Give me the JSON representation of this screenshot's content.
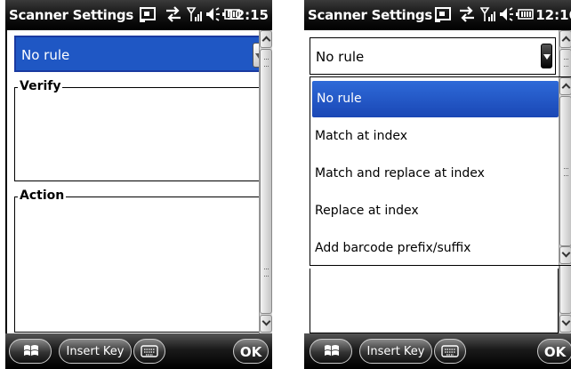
{
  "left": {
    "status_bar": {
      "title": "Scanner Settings",
      "time": "12:15"
    },
    "rule_combo": {
      "value": "No rule"
    },
    "groups": {
      "verify": "Verify",
      "action": "Action"
    },
    "softkeys": {
      "insert_key": "Insert Key",
      "ok": "OK"
    }
  },
  "right": {
    "status_bar": {
      "title": "Scanner Settings",
      "time": "12:16"
    },
    "rule_combo": {
      "value": "No rule"
    },
    "dropdown": {
      "items": [
        {
          "label": "No rule",
          "selected": true
        },
        {
          "label": "Match at index",
          "selected": false
        },
        {
          "label": "Match and replace at index",
          "selected": false
        },
        {
          "label": "Replace at index",
          "selected": false
        },
        {
          "label": "Add barcode prefix/suffix",
          "selected": false
        }
      ]
    },
    "softkeys": {
      "insert_key": "Insert Key",
      "ok": "OK"
    }
  },
  "colors": {
    "selection": "#1f57c4",
    "titlebar": "#000000"
  },
  "icons": [
    "sync-icon",
    "taskbar-connectivity-icon",
    "signal-icon",
    "volume-icon",
    "battery-icon",
    "windows-start-icon",
    "keyboard-icon"
  ]
}
